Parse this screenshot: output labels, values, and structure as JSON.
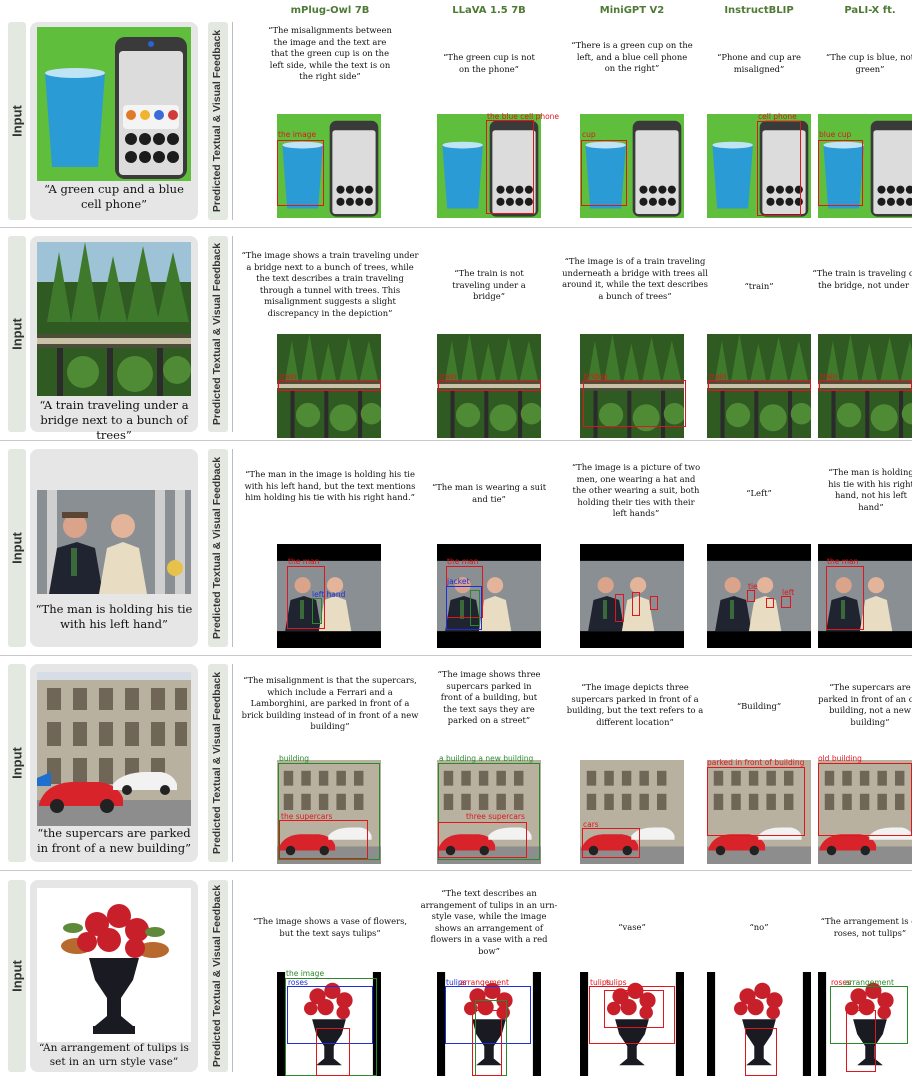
{
  "models": [
    "mPlug-Owl 7B",
    "LLaVA 1.5 7B",
    "MiniGPT V2",
    "InstructBLIP",
    "PaLI-X ft."
  ],
  "labels": {
    "input": "Input",
    "feedback": "Predicted Textual & Visual Feedback"
  },
  "rows": [
    {
      "caption": "“A green cup and a blue cell phone”",
      "feedback": [
        "“The misalignments between the image and the text are that the green cup is on the left side, while the text is on the right side”",
        "“The green cup is not on the phone”",
        "“There is a green cup on the left, and a blue cell phone on the right”",
        "“Phone and cup are misaligned”",
        "“The cup is blue, not green”"
      ],
      "box_labels": [
        "the image",
        "the blue cell phone",
        "cup",
        "cell phone",
        "blue cup"
      ]
    },
    {
      "caption": "“A train traveling under a bridge next to a bunch of trees”",
      "feedback": [
        "“The image shows a train traveling under a bridge next to a bunch of trees, while the text describes a train traveling through a tunnel with trees. This misalignment suggests a slight discrepancy in the depiction”",
        "“The train is not traveling under a bridge”",
        "“The image is of a train traveling underneath a bridge with trees all around it, while the text describes a bunch of trees”",
        "“train”",
        "“The train is traveling over the bridge, not under it”"
      ],
      "box_labels": [
        "train",
        "train",
        "bridge",
        "train",
        "train"
      ]
    },
    {
      "caption": "“The man is holding his tie with his left hand”",
      "feedback": [
        "“The man in the image is holding his tie with his left hand, but the text mentions him holding his tie with his right hand.”",
        "“The man is wearing a suit and tie”",
        "“The image is a picture of two men, one wearing a hat and the other wearing a suit, both holding their ties with their left hands”",
        "“Left”",
        "“The man is holding his tie with his right hand, not his left hand”"
      ],
      "box_labels": [
        "the man",
        "left hand",
        "the man",
        "jacket",
        "tie",
        "left",
        "the man"
      ]
    },
    {
      "caption": "“the supercars are parked in front of a new building”",
      "feedback": [
        "“The misalignment is that the supercars, which include a Ferrari and a Lamborghini, are parked in front of a brick building instead of in front of a new building”",
        "“The image shows three supercars parked in front of a building, but the text says they are parked on a street”",
        "“The image depicts three supercars parked in front of a building, but the text refers to a different location”",
        "“Building”",
        "“The supercars are parked in front of an old building, not a new building”"
      ],
      "box_labels": [
        "building",
        "the supercars",
        "a building a new building",
        "three supercars",
        "cars",
        "parked in front of building",
        "old building"
      ]
    },
    {
      "caption": "“An arrangement of tulips is set in an urn style vase”",
      "feedback": [
        "“The image shows a vase of flowers, but the text says tulips”",
        "“The text describes an arrangement of tulips in an urn-style vase, while the image shows an arrangement of flowers in a vase with a red bow”",
        "“vase”",
        "“no”",
        "“The arrangement is of roses, not tulips”"
      ],
      "box_labels": [
        "the image",
        "roses",
        "tulips",
        "arrangement",
        "tulips",
        "tulips",
        "roses",
        "arrangement"
      ]
    }
  ],
  "colors": {
    "model_title": "#4f7a35",
    "box_red": "#e0161c",
    "box_blue": "#1f2fd6",
    "box_green": "#2a8a2a",
    "panel": "#e6e6e6",
    "tab": "#e3e8e1"
  }
}
